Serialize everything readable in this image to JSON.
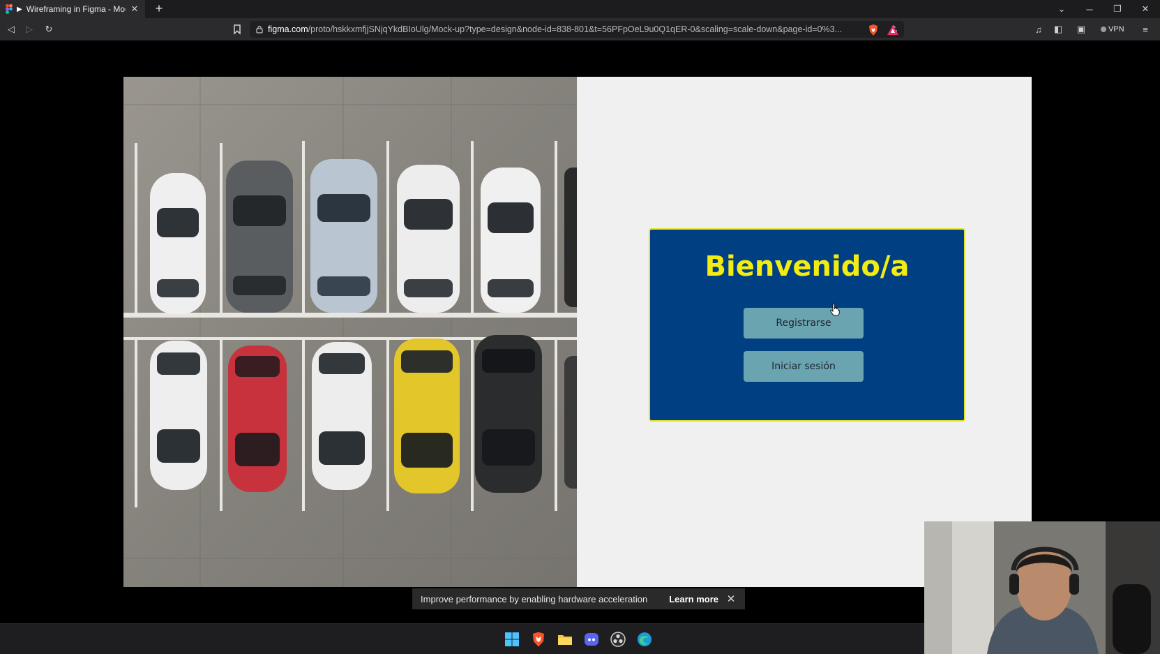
{
  "browser": {
    "tab_title": "Wireframing in Figma - Mock-",
    "tab_close": "✕",
    "new_tab": "+",
    "url_host": "figma.com",
    "url_path": "/proto/hskkxmfjjSNjqYkdBIoUlg/Mock-up?type=design&node-id=838-801&t=56PFpOeL9u0Q1qER-0&scaling=scale-down&page-id=0%3...",
    "vpn_label": "VPN",
    "brand_color": "#fb542b"
  },
  "window_controls": {
    "dropdown": "⌄",
    "minimize": "─",
    "restore": "❐",
    "close": "✕"
  },
  "nav": {
    "back": "◁",
    "forward": "▷",
    "reload": "↻"
  },
  "toolbar_right": {
    "media": "♫",
    "sidebar": "◧",
    "wallet": "▣",
    "menu": "≡"
  },
  "prototype": {
    "title": "Bienvenido/a",
    "register_button": "Registrarse",
    "login_button": "Iniciar sesión",
    "card_color": "#003f82",
    "title_color": "#f2ec13",
    "button_color": "#6aa4b0"
  },
  "notice": {
    "message": "Improve performance by enabling hardware acceleration",
    "learn_more": "Learn more",
    "close": "✕"
  },
  "taskbar": {
    "icons": [
      "windows-start-icon",
      "brave-browser-icon",
      "file-explorer-icon",
      "discord-icon",
      "obs-studio-icon",
      "edge-browser-icon"
    ]
  }
}
